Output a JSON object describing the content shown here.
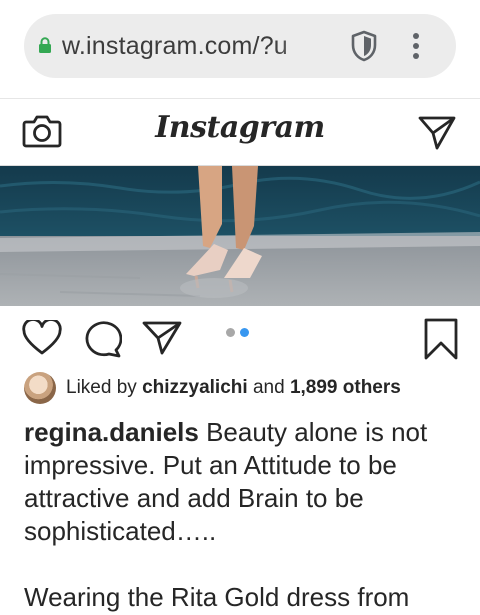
{
  "browser": {
    "url": "w.instagram.com/?u",
    "icons": [
      "lock-icon",
      "shield-icon",
      "more-vert-icon"
    ]
  },
  "header": {
    "logo": "Instagram",
    "icons": [
      "camera-icon",
      "direct-message-icon"
    ]
  },
  "post": {
    "carousel": {
      "count": 2,
      "active_index": 1
    },
    "actions": [
      "like-icon",
      "comment-icon",
      "share-icon",
      "save-icon"
    ],
    "likes": {
      "prefix": "Liked by",
      "user": "chizzyalichi",
      "connector": "and",
      "others": "1,899 others"
    },
    "caption": {
      "username": "regina.daniels",
      "text": "Beauty alone is not impressive. Put an Attitude to be attractive and add Brain to be sophisticated…..",
      "continuation": "Wearing the Rita Gold dress from"
    }
  },
  "colors": {
    "url_bar_bg": "#ececec",
    "lock": "#34a853",
    "carousel_active": "#3897f0",
    "carousel_inactive": "#a8a8a8",
    "text": "#262626"
  }
}
